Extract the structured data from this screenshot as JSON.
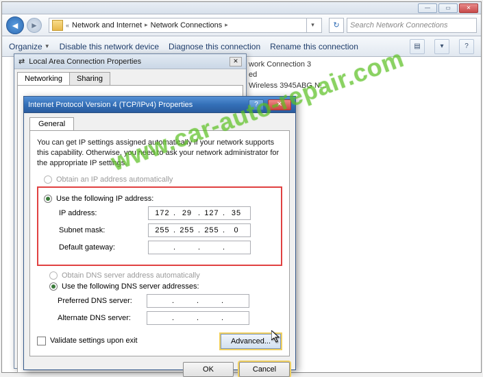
{
  "explorer": {
    "breadcrumb": {
      "item1": "Network and Internet",
      "item2": "Network Connections"
    },
    "search_placeholder": "Search Network Connections",
    "toolbar": {
      "organize": "Organize",
      "disable": "Disable this network device",
      "diagnose": "Diagnose this connection",
      "rename": "Rename this connection"
    },
    "connection": {
      "name_suffix": "work Connection 3",
      "status": "ed",
      "adapter": "Wireless 3945ABG N..."
    }
  },
  "dlg1": {
    "title": "Local Area Connection Properties",
    "tab_networking": "Networking",
    "tab_sharing": "Sharing"
  },
  "dlg2": {
    "title": "Internet Protocol Version 4 (TCP/IPv4) Properties",
    "tab_general": "General",
    "description": "You can get IP settings assigned automatically if your network supports this capability. Otherwise, you need to ask your network administrator for the appropriate IP settings.",
    "radio_auto_ip": "Obtain an IP address automatically",
    "radio_manual_ip": "Use the following IP address:",
    "lbl_ip": "IP address:",
    "lbl_subnet": "Subnet mask:",
    "lbl_gateway": "Default gateway:",
    "ip": {
      "o1": "172",
      "o2": "29",
      "o3": "127",
      "o4": "35"
    },
    "subnet": {
      "o1": "255",
      "o2": "255",
      "o3": "255",
      "o4": "0"
    },
    "gateway": {
      "o1": "",
      "o2": "",
      "o3": "",
      "o4": ""
    },
    "radio_auto_dns": "Obtain DNS server address automatically",
    "radio_manual_dns": "Use the following DNS server addresses:",
    "lbl_pref_dns": "Preferred DNS server:",
    "lbl_alt_dns": "Alternate DNS server:",
    "chk_validate": "Validate settings upon exit",
    "btn_advanced": "Advanced...",
    "btn_ok": "OK",
    "btn_cancel": "Cancel"
  },
  "watermark": "www.car-auto-repair.com"
}
